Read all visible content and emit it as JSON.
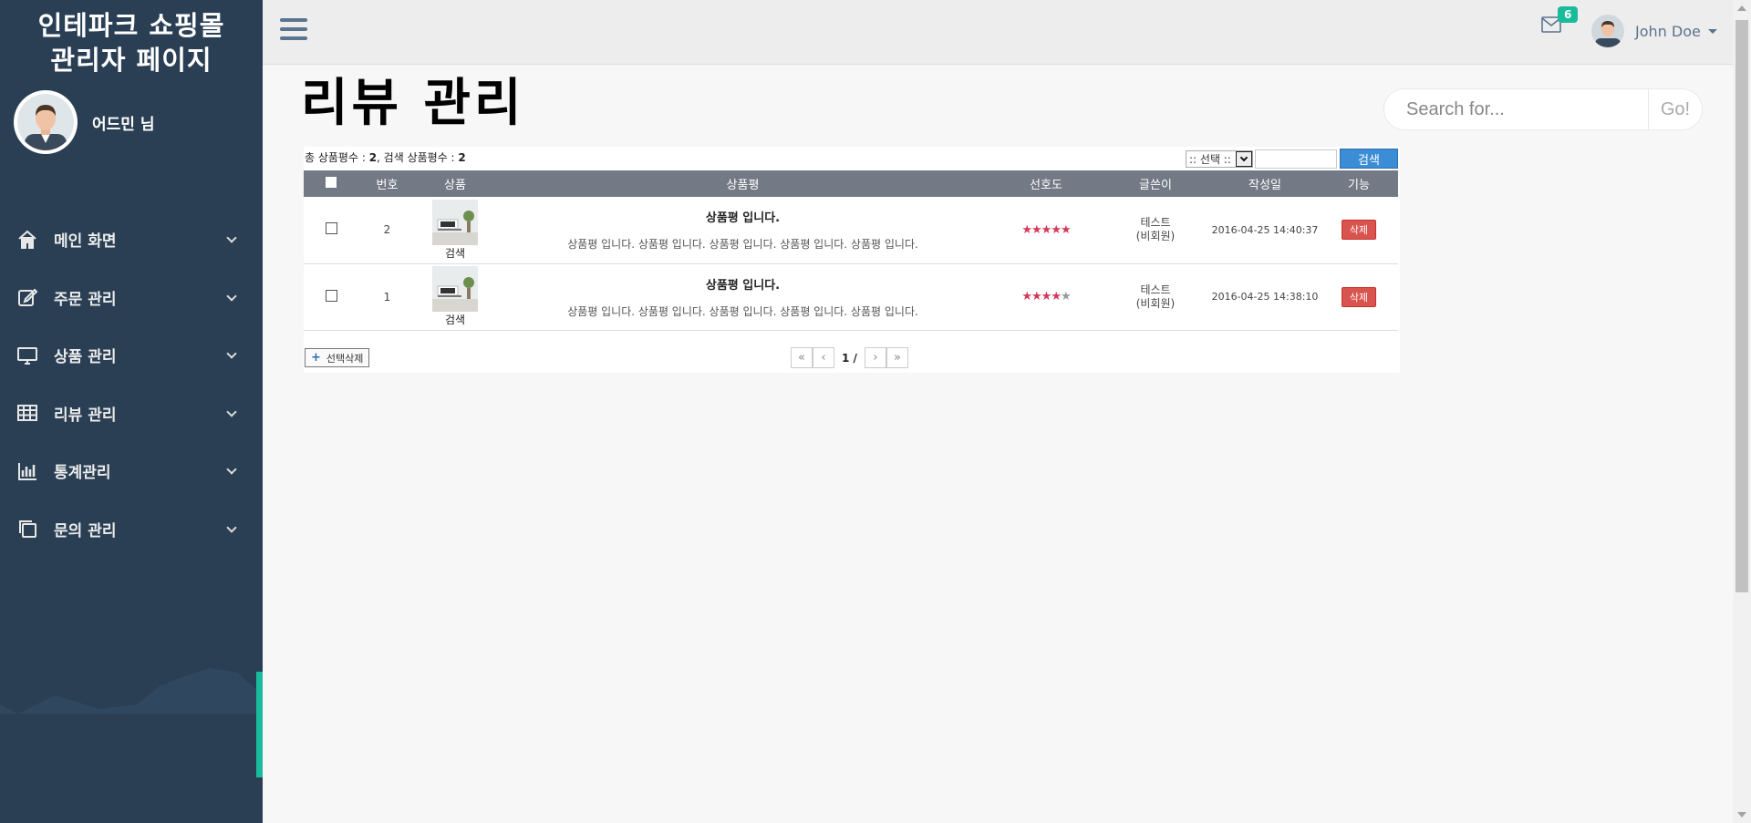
{
  "sidebar": {
    "brand_line1": "인테파크 쇼핑몰",
    "brand_line2": "관리자 페이지",
    "admin_name": "어드민 님",
    "menu": [
      {
        "label": "메인 화면",
        "icon": "home-icon"
      },
      {
        "label": "주문 관리",
        "icon": "edit-icon"
      },
      {
        "label": "상품 관리",
        "icon": "desktop-icon"
      },
      {
        "label": "리뷰 관리",
        "icon": "table-icon"
      },
      {
        "label": "통계관리",
        "icon": "bar-chart-icon"
      },
      {
        "label": "문의 관리",
        "icon": "clone-icon"
      }
    ]
  },
  "topnav": {
    "mail_count": "6",
    "user_name": "John Doe"
  },
  "page": {
    "title": "리뷰 관리",
    "search_placeholder": "Search for...",
    "search_button": "Go!"
  },
  "list": {
    "count_label": "총 상품평수 : ",
    "total": "2",
    "search_count_label": ", 검색 상품평수 : ",
    "search_total": "2",
    "filter_select": ":: 선택 ::",
    "filter_button": "검색",
    "headers": [
      "번호",
      "상품",
      "상품평",
      "선호도",
      "글쓴이",
      "작성일",
      "기능"
    ],
    "rows": [
      {
        "no": "2",
        "product_caption": "검색",
        "review_title": "상품평 입니다.",
        "review_body": "상품평 입니다. 상품평 입니다. 상품평 입니다. 상품평 입니다. 상품평 입니다.",
        "rating": 5,
        "writer": "테스트",
        "writer_type": "(비회원)",
        "date": "2016-04-25 14:40:37",
        "action": "삭제"
      },
      {
        "no": "1",
        "product_caption": "검색",
        "review_title": "상품평 입니다.",
        "review_body": "상품평 입니다. 상품평 입니다. 상품평 입니다. 상품평 입니다. 상품평 입니다.",
        "rating": 4,
        "writer": "테스트",
        "writer_type": "(비회원)",
        "date": "2016-04-25 14:38:10",
        "action": "삭제"
      }
    ],
    "rating_max": 5,
    "bulk_delete": "선택삭제",
    "pager": {
      "current": "1 /"
    }
  },
  "colors": {
    "sidebar_bg": "#2a3f54",
    "accent": "#1abb9c",
    "header_row": "#737a86",
    "star": "#d5385a",
    "delete_btn": "#d9534f",
    "search_btn": "#3b8dd6"
  }
}
